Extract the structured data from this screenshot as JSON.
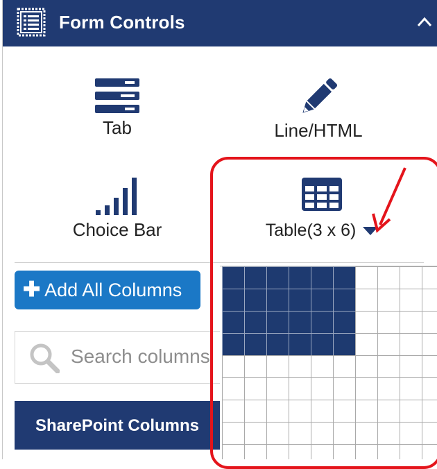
{
  "header": {
    "title": "Form Controls",
    "icon": "form-list-icon",
    "collapse_icon": "chevron-up-icon"
  },
  "controls": [
    {
      "label": "Tab",
      "icon": "tab-icon"
    },
    {
      "label": "Line/HTML",
      "icon": "pencil-icon"
    },
    {
      "label": "Choice Bar",
      "icon": "signal-bars-icon"
    },
    {
      "label": "Table(3 x 6)",
      "icon": "table-icon",
      "dropdown_icon": "caret-down-icon"
    }
  ],
  "add_all_columns": {
    "label": "Add All Columns",
    "icon": "plus-icon"
  },
  "search": {
    "placeholder": "Search columns",
    "icon": "search-icon"
  },
  "section": {
    "title": "SharePoint Columns"
  },
  "table_picker": {
    "selected_rows": 4,
    "selected_cols": 6,
    "visible_rows": 9,
    "visible_cols": 10
  },
  "annotation": {
    "color": "#e4141b"
  },
  "colors": {
    "brand": "#203a72",
    "button": "#1b78c6"
  }
}
